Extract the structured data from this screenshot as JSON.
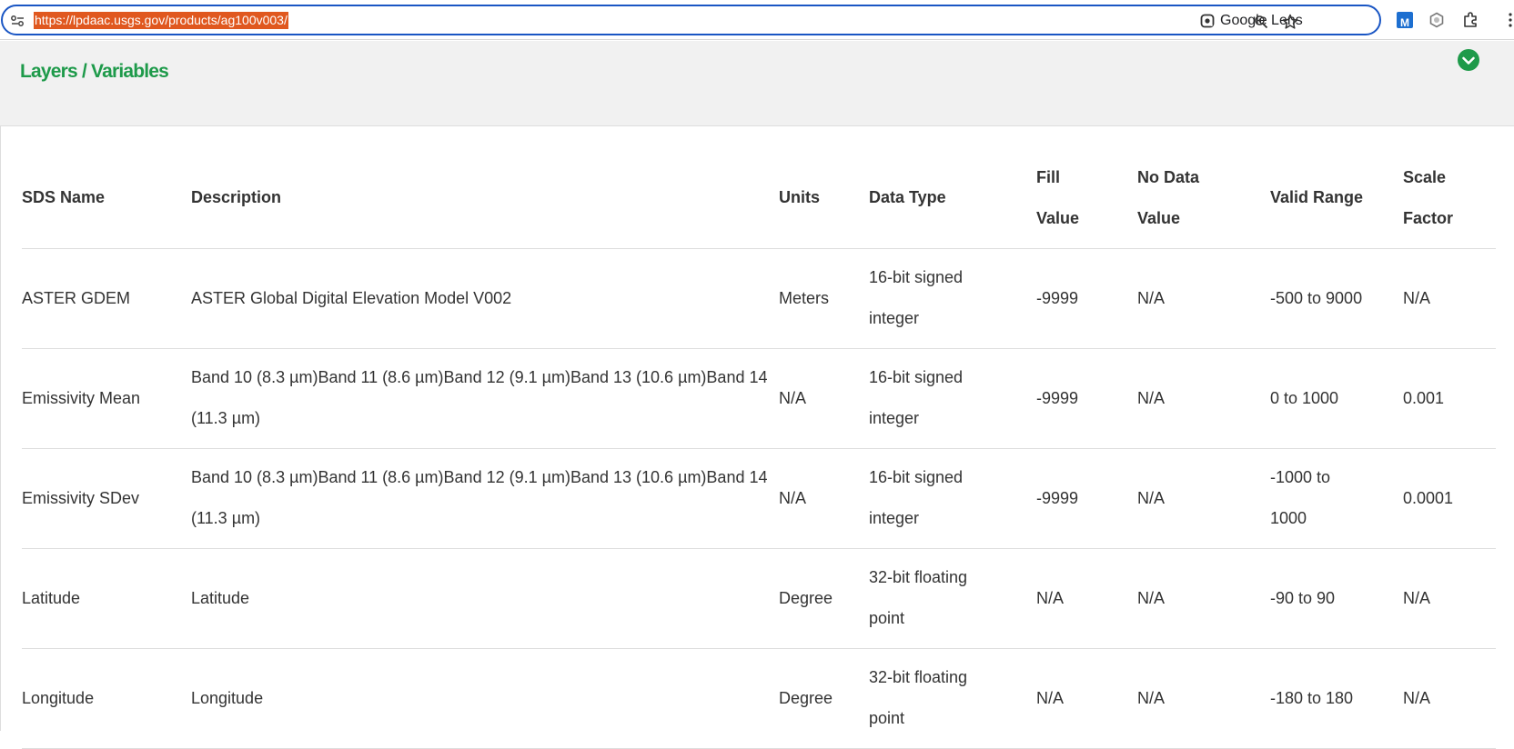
{
  "browser": {
    "url": "https://lpdaac.usgs.gov/products/ag100v003/",
    "lens_label": "Google Lens",
    "extension_label": "M"
  },
  "section": {
    "title": "Layers / Variables"
  },
  "table": {
    "headers": {
      "sds_name": "SDS Name",
      "description": "Description",
      "units": "Units",
      "data_type": "Data Type",
      "fill_value": "Fill Value",
      "no_data_value": "No Data Value",
      "valid_range": "Valid Range",
      "scale_factor": "Scale Factor"
    },
    "rows": [
      {
        "sds_name": "ASTER GDEM",
        "description": "ASTER Global Digital Elevation Model V002",
        "units": "Meters",
        "data_type": "16-bit signed integer",
        "fill_value": "-9999",
        "no_data_value": "N/A",
        "valid_range": "-500 to 9000",
        "scale_factor": "N/A"
      },
      {
        "sds_name": "Emissivity Mean",
        "description": "Band 10 (8.3 µm)Band 11 (8.6 µm)Band 12 (9.1 µm)Band 13 (10.6 µm)Band 14 (11.3 µm)",
        "units": "N/A",
        "data_type": "16-bit signed integer",
        "fill_value": "-9999",
        "no_data_value": "N/A",
        "valid_range": "0 to 1000",
        "scale_factor": "0.001"
      },
      {
        "sds_name": "Emissivity SDev",
        "description": "Band 10 (8.3 µm)Band 11 (8.6 µm)Band 12 (9.1 µm)Band 13 (10.6 µm)Band 14 (11.3 µm)",
        "units": "N/A",
        "data_type": "16-bit signed integer",
        "fill_value": "-9999",
        "no_data_value": "N/A",
        "valid_range": "-1000 to 1000",
        "scale_factor": "0.0001"
      },
      {
        "sds_name": "Latitude",
        "description": "Latitude",
        "units": "Degree",
        "data_type": "32-bit floating point",
        "fill_value": "N/A",
        "no_data_value": "N/A",
        "valid_range": "-90 to 90",
        "scale_factor": "N/A"
      },
      {
        "sds_name": "Longitude",
        "description": "Longitude",
        "units": "Degree",
        "data_type": "32-bit floating point",
        "fill_value": "N/A",
        "no_data_value": "N/A",
        "valid_range": "-180 to 180",
        "scale_factor": "N/A"
      }
    ]
  },
  "colors": {
    "accent_green": "#1e9a4a",
    "omnibox_border": "#1a56c4",
    "url_highlight": "#e0581f"
  }
}
